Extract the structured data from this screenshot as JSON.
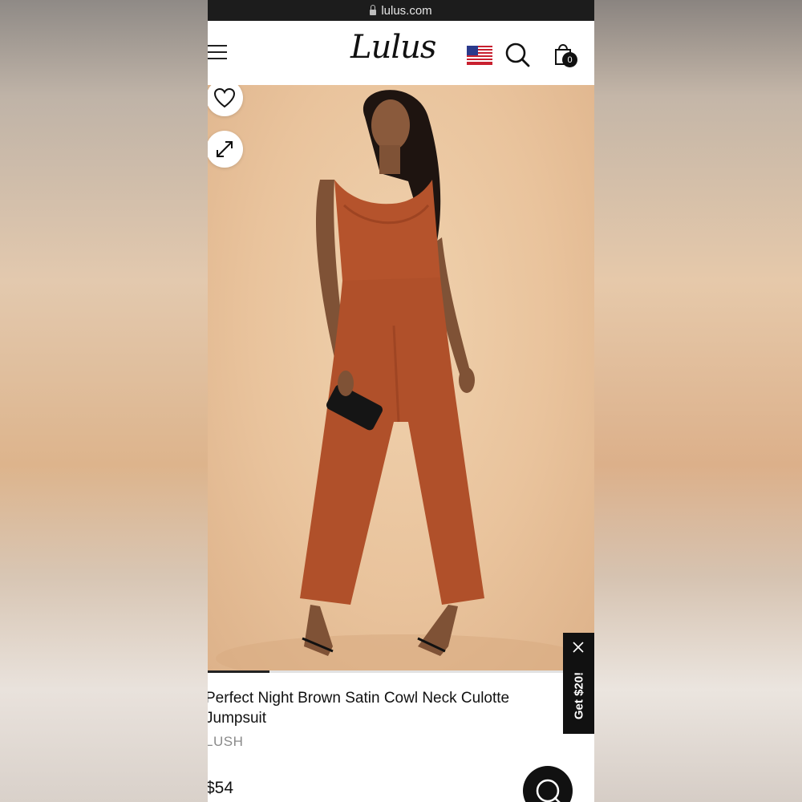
{
  "browser": {
    "url": "lulus.com"
  },
  "header": {
    "logo": "Lulus",
    "cart_count": "0"
  },
  "gallery": {
    "progress": 0.16
  },
  "product": {
    "title": "Perfect Night Brown Satin Cowl Neck Culotte Jumpsuit",
    "brand": "LUSH",
    "price": "$54"
  },
  "promo": {
    "label": "Get $20!"
  },
  "colors": {
    "accent": "#111111",
    "fabric": "#b5532c",
    "backdrop": "#e9c39c"
  }
}
